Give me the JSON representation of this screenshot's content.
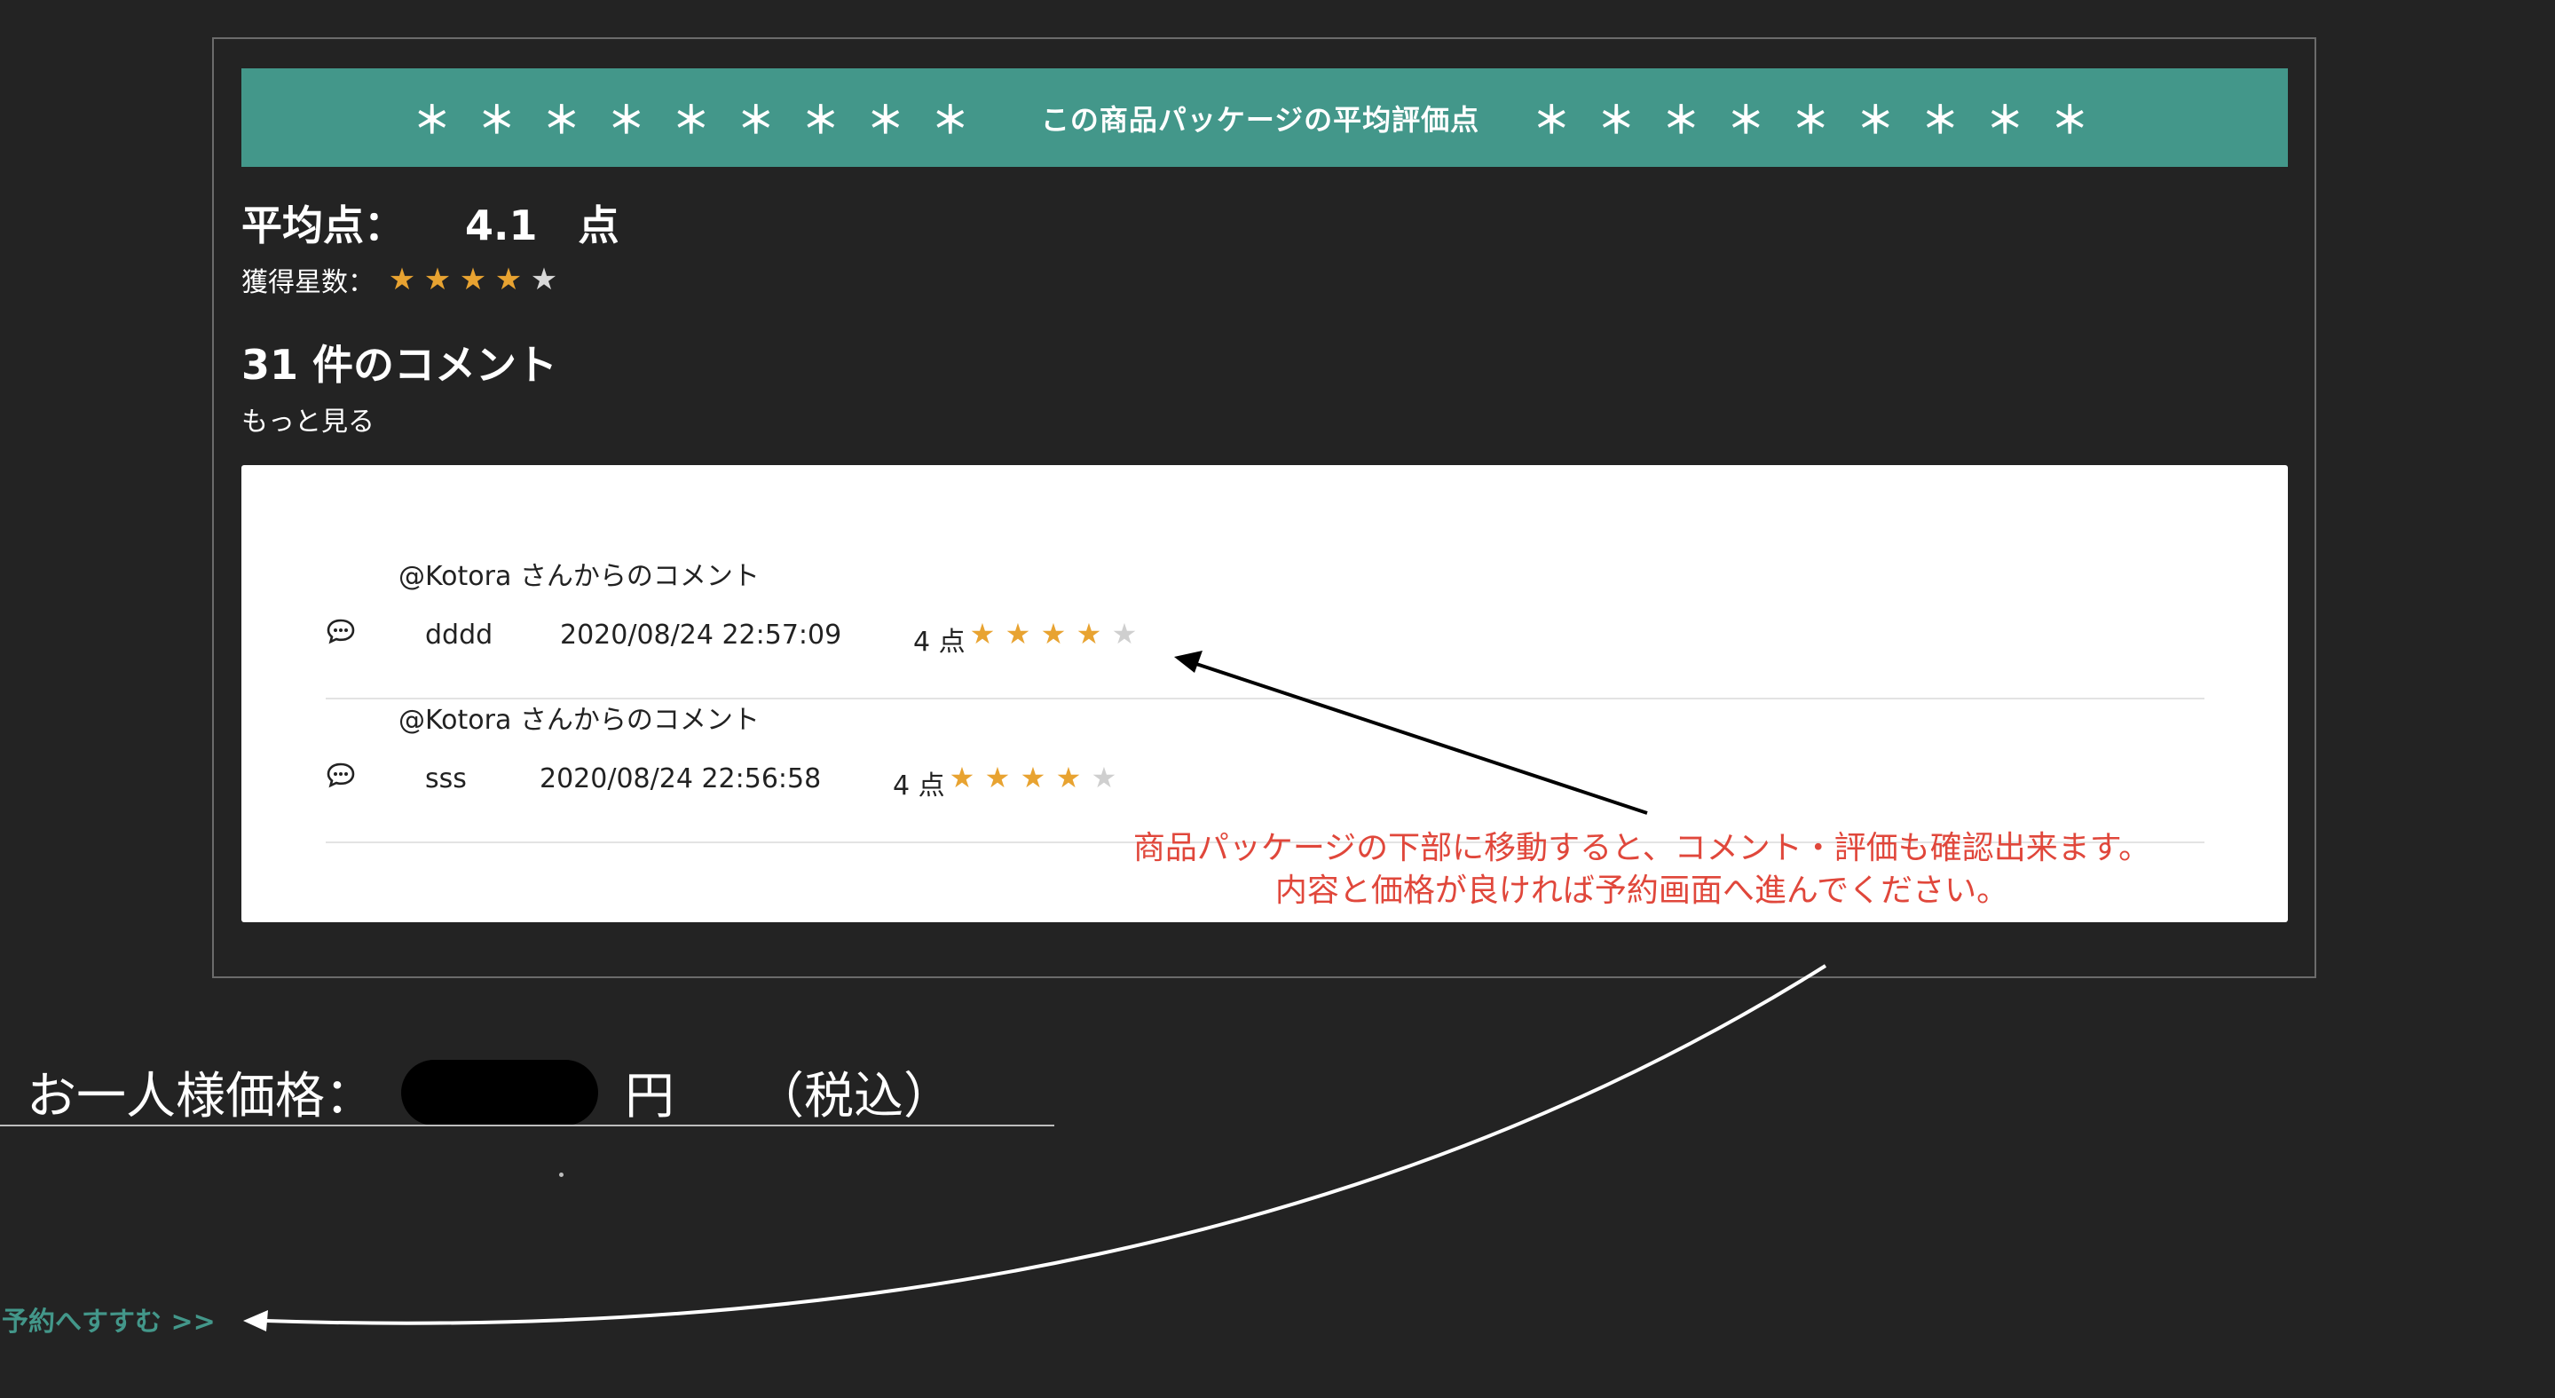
{
  "banner": {
    "left_stars": "＊＊＊＊＊＊＊＊＊",
    "title": "この商品パッケージの平均評価点",
    "right_stars": "＊＊＊＊＊＊＊＊＊"
  },
  "rating": {
    "label": "平均点：",
    "value": "4.1",
    "unit": "点",
    "stars_label": "獲得星数：",
    "stars_filled": 4,
    "stars_total": 5
  },
  "comments_header": {
    "count_text": "31 件のコメント",
    "more_link": "もっと見る"
  },
  "comments": [
    {
      "from": "@Kotora さんからのコメント",
      "text": "dddd",
      "datetime": "2020/08/24 22:57:09",
      "score": "4 点",
      "stars_filled": 4
    },
    {
      "from": "@Kotora さんからのコメント",
      "text": "sss",
      "datetime": "2020/08/24 22:56:58",
      "score": "4 点",
      "stars_filled": 4
    }
  ],
  "annotation": {
    "line1": "商品パッケージの下部に移動すると、コメント・評価も確認出来ます。",
    "line2": "内容と価格が良ければ予約画面へ進んでください。"
  },
  "price": {
    "label": "お一人様価格：",
    "currency": "円",
    "tax": "（税込）"
  },
  "reserve_link": "予約へすすむ >>",
  "colors": {
    "background": "#232323",
    "banner": "#43978a",
    "annotation": "#e0473b",
    "star_on": "#e8a331",
    "star_off": "#d8d8d8"
  }
}
